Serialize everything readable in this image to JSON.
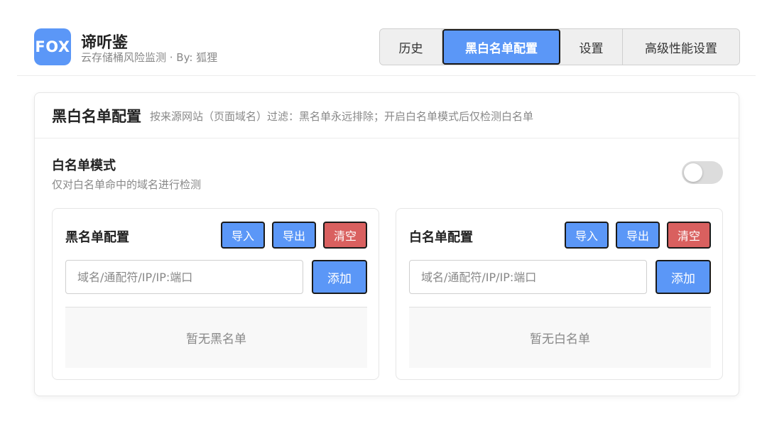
{
  "app": {
    "logo_text": "FOX",
    "title": "谛听鉴",
    "subtitle": "云存储桶风险监测 · By: 狐狸"
  },
  "tabs": [
    {
      "label": "历史",
      "active": false
    },
    {
      "label": "黑白名单配置",
      "active": true
    },
    {
      "label": "设置",
      "active": false
    },
    {
      "label": "高级性能设置",
      "active": false
    }
  ],
  "config": {
    "title": "黑白名单配置",
    "description": "按来源网站（页面域名）过滤：黑名单永远排除；开启白名单模式后仅检测白名单"
  },
  "whitelist_mode": {
    "title": "白名单模式",
    "description": "仅对白名单命中的域名进行检测",
    "enabled": false
  },
  "blacklist": {
    "title": "黑名单配置",
    "import_label": "导入",
    "export_label": "导出",
    "clear_label": "清空",
    "input_placeholder": "域名/通配符/IP/IP:端口",
    "input_value": "",
    "add_label": "添加",
    "empty_text": "暂无黑名单"
  },
  "whitelist": {
    "title": "白名单配置",
    "import_label": "导入",
    "export_label": "导出",
    "clear_label": "清空",
    "input_placeholder": "域名/通配符/IP/IP:端口",
    "input_value": "",
    "add_label": "添加",
    "empty_text": "暂无白名单"
  },
  "colors": {
    "accent": "#5b97f7",
    "danger": "#d9605f",
    "toggle_off": "#dcdcdc"
  }
}
